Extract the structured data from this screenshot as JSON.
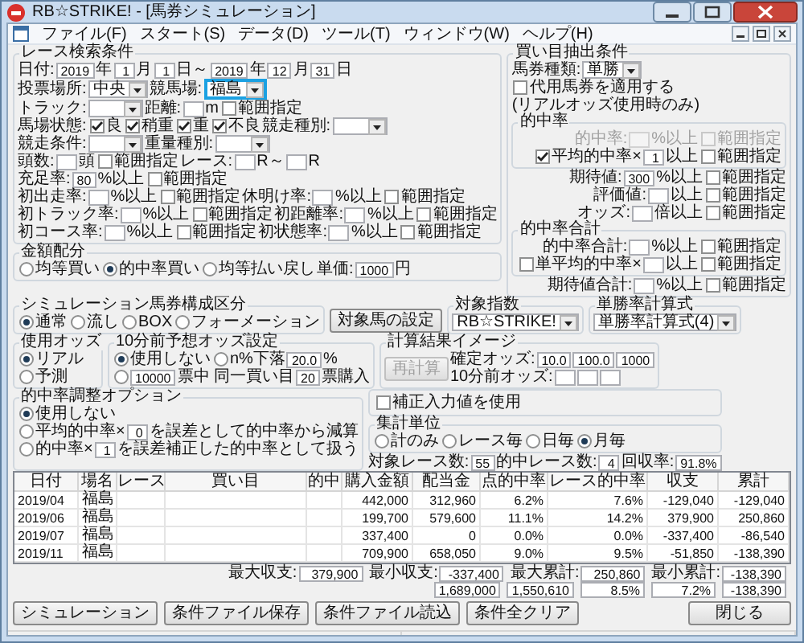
{
  "window": {
    "title": "RB☆STRIKE! - [馬券シミュレーション]"
  },
  "menu": [
    "ファイル(F)",
    "スタート(S)",
    "データ(D)",
    "ツール(T)",
    "ウィンドウ(W)",
    "ヘルプ(H)"
  ],
  "race_search": {
    "title": "レース検索条件",
    "rows": [
      {
        "items": [
          {
            "kind": "label",
            "text": "日付:"
          },
          {
            "kind": "input",
            "value": "2019"
          },
          {
            "kind": "label",
            "text": "年"
          },
          {
            "kind": "input",
            "value": "1"
          },
          {
            "kind": "label",
            "text": "月"
          },
          {
            "kind": "input",
            "value": "1"
          },
          {
            "kind": "label",
            "text": "日～"
          },
          {
            "kind": "input",
            "value": "2019"
          },
          {
            "kind": "label",
            "text": "年"
          },
          {
            "kind": "input",
            "value": "12"
          },
          {
            "kind": "label",
            "text": "月"
          },
          {
            "kind": "input",
            "value": "31"
          },
          {
            "kind": "label",
            "text": "日"
          }
        ]
      },
      {
        "items": [
          {
            "kind": "label",
            "text": "投票場所:"
          },
          {
            "kind": "select",
            "value": "中央",
            "focused": false
          },
          {
            "kind": "label",
            "text": "競馬場:"
          },
          {
            "kind": "select",
            "value": "福島",
            "focused": true
          }
        ]
      },
      {
        "items": [
          {
            "kind": "label",
            "text": "トラック:"
          },
          {
            "kind": "select",
            "focused": false
          },
          {
            "kind": "label",
            "text": "距離:"
          },
          {
            "kind": "input"
          },
          {
            "kind": "label",
            "text": "m"
          },
          {
            "kind": "check",
            "label": "範囲指定",
            "checked": false
          }
        ]
      },
      {
        "items": [
          {
            "kind": "label",
            "text": "馬場状態:"
          },
          {
            "kind": "check",
            "label": "良",
            "checked": true
          },
          {
            "kind": "check",
            "label": "稍重",
            "checked": true
          },
          {
            "kind": "check",
            "label": "重",
            "checked": true
          },
          {
            "kind": "check",
            "label": "不良",
            "checked": true
          },
          {
            "kind": "label",
            "text": "競走種別:"
          },
          {
            "kind": "select",
            "focused": false
          }
        ]
      },
      {
        "items": [
          {
            "kind": "label",
            "text": "競走条件:"
          },
          {
            "kind": "select",
            "focused": false
          },
          {
            "kind": "label",
            "text": "重量種別:"
          },
          {
            "kind": "select",
            "focused": false
          }
        ]
      },
      {
        "items": [
          {
            "kind": "label",
            "text": "頭数:"
          },
          {
            "kind": "input"
          },
          {
            "kind": "label",
            "text": "頭"
          },
          {
            "kind": "check",
            "label": "範囲指定",
            "checked": false
          },
          {
            "kind": "label",
            "text": "レース:"
          },
          {
            "kind": "input"
          },
          {
            "kind": "label",
            "text": "R～"
          },
          {
            "kind": "input"
          },
          {
            "kind": "label",
            "text": "R"
          }
        ]
      },
      {
        "items": [
          {
            "kind": "label",
            "text": "充足率:"
          },
          {
            "kind": "input",
            "value": "80"
          },
          {
            "kind": "label",
            "text": "%以上"
          },
          {
            "kind": "check",
            "label": "範囲指定",
            "checked": false
          }
        ]
      },
      {
        "items": [
          {
            "kind": "label",
            "text": "初出走率:"
          },
          {
            "kind": "input"
          },
          {
            "kind": "label",
            "text": "%以上"
          },
          {
            "kind": "check",
            "label": "範囲指定",
            "checked": false
          },
          {
            "kind": "label",
            "text": "休明け率:"
          },
          {
            "kind": "input"
          },
          {
            "kind": "label",
            "text": "%以上"
          },
          {
            "kind": "check",
            "label": "範囲指定",
            "checked": false
          }
        ]
      },
      {
        "items": [
          {
            "kind": "label",
            "text": "初トラック率:"
          },
          {
            "kind": "input"
          },
          {
            "kind": "label",
            "text": "%以上"
          },
          {
            "kind": "check",
            "label": "範囲指定",
            "checked": false
          },
          {
            "kind": "label",
            "text": "初距離率:"
          },
          {
            "kind": "input"
          },
          {
            "kind": "label",
            "text": "%以上"
          },
          {
            "kind": "check",
            "label": "範囲指定",
            "checked": false
          }
        ]
      },
      {
        "items": [
          {
            "kind": "label",
            "text": "初コース率:"
          },
          {
            "kind": "input"
          },
          {
            "kind": "label",
            "text": "%以上"
          },
          {
            "kind": "check",
            "label": "範囲指定",
            "checked": false
          },
          {
            "kind": "label",
            "text": "初状態率:"
          },
          {
            "kind": "input"
          },
          {
            "kind": "label",
            "text": "%以上"
          },
          {
            "kind": "check",
            "label": "範囲指定",
            "checked": false
          }
        ]
      }
    ]
  },
  "bet_extraction": {
    "title": "買い目抽出条件",
    "ticket_rows": [
      {
        "items": [
          {
            "kind": "label",
            "text": "馬券種類:"
          },
          {
            "kind": "select",
            "value": "単勝",
            "focused": false
          }
        ]
      },
      {
        "items": [
          {
            "kind": "check",
            "label": "代用馬券を適用する",
            "checked": false
          }
        ]
      },
      {
        "items": [
          {
            "kind": "label",
            "text": "(リアルオッズ使用時のみ)"
          }
        ]
      }
    ],
    "rows": [
      {
        "items": [
          {
            "kind": "group",
            "title": "的中率",
            "rows": [
              {
                "items": [
                  {
                    "kind": "label",
                    "text": "的中率:",
                    "disabled": true
                  },
                  {
                    "kind": "input",
                    "disabled": true
                  },
                  {
                    "kind": "label",
                    "text": "%以上",
                    "disabled": true
                  },
                  {
                    "kind": "check",
                    "label": "範囲指定",
                    "checked": false,
                    "disabled": true
                  }
                ]
              },
              {
                "items": [
                  {
                    "kind": "check",
                    "label": "平均的中率×",
                    "checked": true
                  },
                  {
                    "kind": "input",
                    "value": "1"
                  },
                  {
                    "kind": "label",
                    "text": "以上"
                  },
                  {
                    "kind": "check",
                    "label": "範囲指定",
                    "checked": false
                  }
                ]
              }
            ]
          }
        ]
      },
      {
        "items": [
          {
            "kind": "label",
            "text": "期待値:"
          },
          {
            "kind": "input",
            "value": "300"
          },
          {
            "kind": "label",
            "text": "%以上"
          },
          {
            "kind": "check",
            "label": "範囲指定",
            "checked": false
          }
        ]
      },
      {
        "items": [
          {
            "kind": "label",
            "text": "評価値:"
          },
          {
            "kind": "input"
          },
          {
            "kind": "label",
            "text": "以上"
          },
          {
            "kind": "check",
            "label": "範囲指定",
            "checked": false
          }
        ]
      },
      {
        "items": [
          {
            "kind": "label",
            "text": "オッズ:"
          },
          {
            "kind": "input"
          },
          {
            "kind": "label",
            "text": "倍以上"
          },
          {
            "kind": "check",
            "label": "範囲指定",
            "checked": false
          }
        ]
      },
      {
        "items": [
          {
            "kind": "group",
            "title": "的中率合計",
            "rows": [
              {
                "items": [
                  {
                    "kind": "label",
                    "text": "的中率合計:"
                  },
                  {
                    "kind": "input"
                  },
                  {
                    "kind": "label",
                    "text": "%以上"
                  },
                  {
                    "kind": "check",
                    "label": "範囲指定",
                    "checked": false
                  }
                ]
              },
              {
                "items": [
                  {
                    "kind": "check",
                    "label": "単平均的中率×",
                    "checked": false
                  },
                  {
                    "kind": "input"
                  },
                  {
                    "kind": "label",
                    "text": "以上"
                  },
                  {
                    "kind": "check",
                    "label": "範囲指定",
                    "checked": false
                  }
                ]
              }
            ]
          }
        ]
      },
      {
        "items": [
          {
            "kind": "label",
            "text": "期待値合計:"
          },
          {
            "kind": "input"
          },
          {
            "kind": "label",
            "text": "%以上"
          },
          {
            "kind": "check",
            "label": "範囲指定",
            "checked": false
          }
        ]
      }
    ]
  },
  "allocation": {
    "title": "金額配分",
    "rows": [
      {
        "items": [
          {
            "kind": "radio",
            "label": "均等買い",
            "selected": false
          },
          {
            "kind": "radio",
            "label": "的中率買い",
            "selected": true
          },
          {
            "kind": "radio",
            "label": "均等払い戻し",
            "selected": false
          },
          {
            "kind": "label",
            "text": "単価:"
          },
          {
            "kind": "input",
            "value": "1000"
          },
          {
            "kind": "label",
            "text": "円"
          }
        ]
      }
    ]
  },
  "simulation_type": {
    "title": "シミュレーション馬券構成区分",
    "rows": [
      {
        "items": [
          {
            "kind": "radio",
            "label": "通常",
            "selected": true
          },
          {
            "kind": "radio",
            "label": "流し",
            "selected": false
          },
          {
            "kind": "radio",
            "label": "BOX",
            "selected": false
          },
          {
            "kind": "radio",
            "label": "フォーメーション",
            "selected": false
          }
        ]
      }
    ]
  },
  "target_button": "対象馬の設定",
  "target_index": {
    "title": "対象指数",
    "rows": [
      {
        "items": [
          {
            "kind": "select",
            "value": "RB☆STRIKE!",
            "focused": false
          }
        ]
      }
    ]
  },
  "win_rate_formula": {
    "title": "単勝率計算式",
    "rows": [
      {
        "items": [
          {
            "kind": "select",
            "value": "単勝率計算式(4)",
            "focused": false
          }
        ]
      }
    ]
  },
  "odds_used": {
    "title": "使用オッズ",
    "rows": [
      {
        "items": [
          {
            "kind": "radio",
            "label": "リアル",
            "selected": true
          }
        ]
      },
      {
        "items": [
          {
            "kind": "radio",
            "label": "予測",
            "selected": false
          }
        ]
      }
    ]
  },
  "pre_odds": {
    "title": "10分前予想オッズ設定",
    "rows": [
      {
        "items": [
          {
            "kind": "radio",
            "label": "使用しない",
            "selected": true
          },
          {
            "kind": "radio",
            "label": "n%下落",
            "selected": false
          },
          {
            "kind": "input",
            "value": "20.0"
          },
          {
            "kind": "label",
            "text": "%"
          }
        ]
      },
      {
        "items": [
          {
            "kind": "radio",
            "selected": false
          },
          {
            "kind": "input",
            "value": "10000"
          },
          {
            "kind": "label",
            "text": "票中 同一買い目"
          },
          {
            "kind": "input",
            "value": "20"
          },
          {
            "kind": "label",
            "text": "票購入"
          }
        ]
      }
    ]
  },
  "calc_preview": {
    "title": "計算結果イメージ",
    "rows": [
      {
        "items": [
          {
            "kind": "button",
            "label": "再計算",
            "disabled": true
          },
          {
            "kind": "column",
            "rows": [
              {
                "items": [
                  {
                    "kind": "label",
                    "text": "確定オッズ:"
                  },
                  {
                    "kind": "input",
                    "value": "10.0"
                  },
                  {
                    "kind": "input",
                    "value": "100.0"
                  },
                  {
                    "kind": "input",
                    "value": "1000"
                  }
                ]
              },
              {
                "items": [
                  {
                    "kind": "label",
                    "text": "10分前オッズ:"
                  },
                  {
                    "kind": "input"
                  },
                  {
                    "kind": "input"
                  },
                  {
                    "kind": "input"
                  }
                ]
              }
            ]
          }
        ]
      }
    ]
  },
  "correction": {
    "rows": [
      {
        "items": [
          {
            "kind": "check",
            "label": "補正入力値を使用",
            "checked": false
          }
        ]
      }
    ]
  },
  "hit_adjust": {
    "title": "的中率調整オプション",
    "rows": [
      {
        "items": [
          {
            "kind": "radio",
            "label": "使用しない",
            "selected": true
          }
        ]
      },
      {
        "items": [
          {
            "kind": "radio",
            "label": "平均的中率×",
            "selected": false
          },
          {
            "kind": "input",
            "value": "0"
          },
          {
            "kind": "label",
            "text": "を誤差として的中率から減算"
          }
        ]
      },
      {
        "items": [
          {
            "kind": "radio",
            "label": "的中率×",
            "selected": false
          },
          {
            "kind": "input",
            "value": "1"
          },
          {
            "kind": "label",
            "text": "を誤差補正した的中率として扱う"
          }
        ]
      }
    ]
  },
  "aggregation": {
    "title": "集計単位",
    "rows": [
      {
        "items": [
          {
            "kind": "radio",
            "label": "計のみ",
            "selected": false
          },
          {
            "kind": "radio",
            "label": "レース毎",
            "selected": false
          },
          {
            "kind": "radio",
            "label": "日毎",
            "selected": false
          },
          {
            "kind": "radio",
            "label": "月毎",
            "selected": true
          }
        ]
      }
    ]
  },
  "counts": [
    {
      "kind": "label",
      "text": "対象レース数:"
    },
    {
      "kind": "input",
      "value": "55"
    },
    {
      "kind": "label",
      "text": "的中レース数:"
    },
    {
      "kind": "input",
      "value": "4"
    },
    {
      "kind": "label",
      "text": "回収率:"
    },
    {
      "kind": "input",
      "value": "91.8%"
    }
  ],
  "results_table": {
    "columns": [
      "日付",
      "場名",
      "レース",
      "買い目",
      "的中",
      "購入金額",
      "配当金",
      "点的中率",
      "レース的中率",
      "収支",
      "累計"
    ],
    "rows": [
      {
        "date": "2019/04",
        "venue": "福島",
        "purchase": "442,000",
        "payout": "312,960",
        "point_hit_rate": "6.2%",
        "race_hit_rate": "7.6%",
        "balance": "-129,040",
        "cumulative": "-129,040"
      },
      {
        "date": "2019/06",
        "venue": "福島",
        "purchase": "199,700",
        "payout": "579,600",
        "point_hit_rate": "11.1%",
        "race_hit_rate": "14.2%",
        "balance": "379,900",
        "cumulative": "250,860"
      },
      {
        "date": "2019/07",
        "venue": "福島",
        "purchase": "337,400",
        "payout": "0",
        "point_hit_rate": "0.0%",
        "race_hit_rate": "0.0%",
        "balance": "-337,400",
        "cumulative": "-86,540"
      },
      {
        "date": "2019/11",
        "venue": "福島",
        "purchase": "709,900",
        "payout": "658,050",
        "point_hit_rate": "9.0%",
        "race_hit_rate": "9.5%",
        "balance": "-51,850",
        "cumulative": "-138,390"
      }
    ]
  },
  "summary": {
    "stats": [
      {
        "label": "最大収支:",
        "value": "379,900"
      },
      {
        "label": "最小収支:",
        "value": "-337,400"
      },
      {
        "label": "最大累計:",
        "value": "250,860"
      },
      {
        "label": "最小累計:",
        "value": "-138,390"
      }
    ],
    "totals": [
      "1,689,000",
      "1,550,610",
      "8.5%",
      "7.2%",
      "-138,390"
    ]
  },
  "buttons": [
    "シミュレーション",
    "条件ファイル保存",
    "条件ファイル読込",
    "条件全クリア"
  ],
  "close_button": "閉じる"
}
